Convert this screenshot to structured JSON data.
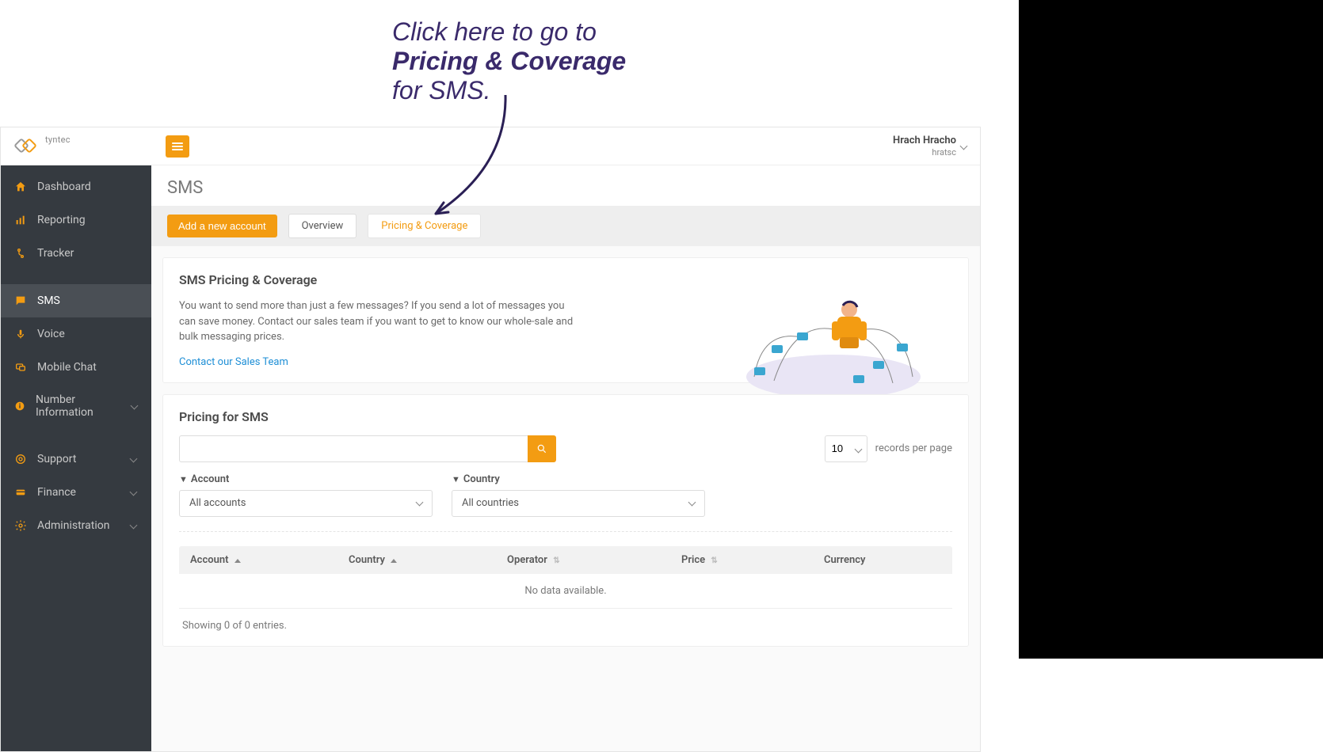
{
  "annotation": {
    "line1": "Click here to go to",
    "line2": "Pricing & Coverage",
    "line3": "for SMS."
  },
  "logo_text": "tyntec",
  "user": {
    "name": "Hrach Hracho",
    "handle": "hratsc"
  },
  "sidebar": {
    "items": [
      {
        "label": "Dashboard",
        "icon": "home-icon"
      },
      {
        "label": "Reporting",
        "icon": "reporting-icon"
      },
      {
        "label": "Tracker",
        "icon": "tracker-icon"
      },
      {
        "label": "SMS",
        "icon": "sms-icon",
        "active": true
      },
      {
        "label": "Voice",
        "icon": "voice-icon"
      },
      {
        "label": "Mobile Chat",
        "icon": "mobile-chat-icon"
      },
      {
        "label": "Number Information",
        "icon": "number-info-icon",
        "expandable": true
      },
      {
        "label": "Support",
        "icon": "support-icon",
        "expandable": true
      },
      {
        "label": "Finance",
        "icon": "finance-icon",
        "expandable": true
      },
      {
        "label": "Administration",
        "icon": "administration-icon",
        "expandable": true
      }
    ]
  },
  "page": {
    "title": "SMS"
  },
  "actions": {
    "add_account": "Add a new account"
  },
  "tabs": [
    {
      "label": "Overview",
      "active": false
    },
    {
      "label": "Pricing & Coverage",
      "active": true
    }
  ],
  "coverage_card": {
    "heading": "SMS Pricing & Coverage",
    "body": "You want to send more than just a few messages? If you send a lot of messages you can save money. Contact our sales team if you want to get to know our whole-sale and bulk messaging prices.",
    "link": "Contact our Sales Team"
  },
  "pricing_card": {
    "heading": "Pricing for SMS",
    "records_per_page_value": "10",
    "records_per_page_label": "records per page",
    "filter_account_label": "Account",
    "filter_account_value": "All accounts",
    "filter_country_label": "Country",
    "filter_country_value": "All countries",
    "columns": {
      "account": "Account",
      "country": "Country",
      "operator": "Operator",
      "price": "Price",
      "currency": "Currency"
    },
    "empty": "No data available.",
    "info": "Showing 0 of 0 entries."
  }
}
